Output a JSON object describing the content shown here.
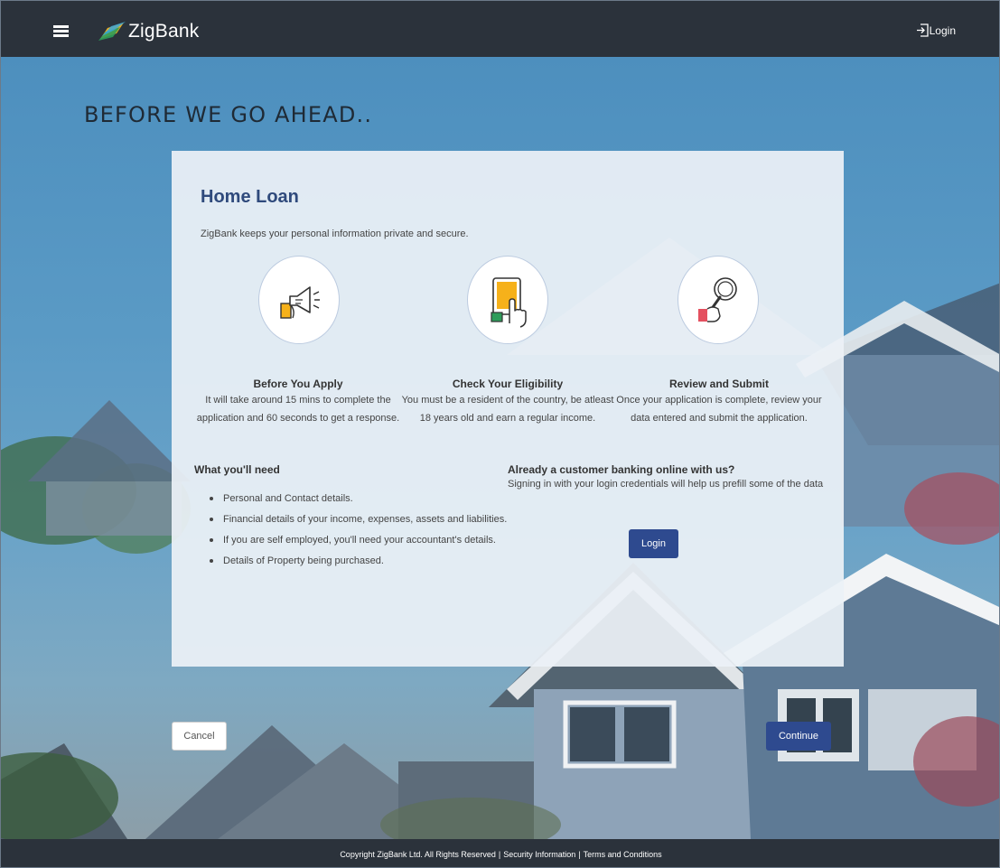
{
  "header": {
    "brand": "ZigBank",
    "login_label": "Login"
  },
  "page": {
    "heading": "BEFORE WE GO AHEAD.."
  },
  "card": {
    "title": "Home Loan",
    "subtitle": "ZigBank keeps your personal information private and secure.",
    "steps": [
      {
        "icon": "megaphone-icon",
        "title": "Before You Apply",
        "description": "It will take around 15 mins to complete the application and 60 seconds to get a response."
      },
      {
        "icon": "tablet-touch-icon",
        "title": "Check Your Eligibility",
        "description": "You must be a resident of the country, be atleast 18 years old and earn a regular income."
      },
      {
        "icon": "magnifier-icon",
        "title": "Review and Submit",
        "description": "Once your application is complete, review your data entered and submit the application."
      }
    ],
    "needs": {
      "title": "What you'll need",
      "items": [
        "Personal and Contact details.",
        "Financial details of your income, expenses, assets and liabilities.",
        "If you are self employed, you'll need your accountant's details.",
        "Details of Property being purchased."
      ]
    },
    "existing_customer": {
      "title": "Already a customer banking online with us?",
      "description": "Signing in with your login credentials will help us prefill some of the data",
      "login_label": "Login"
    }
  },
  "actions": {
    "cancel_label": "Cancel",
    "continue_label": "Continue"
  },
  "footer": {
    "copyright": "Copyright ZigBank Ltd. All Rights Reserved",
    "security_link": "Security Information",
    "terms_link": "Terms and Conditions",
    "separator": "|"
  },
  "colors": {
    "topbar": "#2b323b",
    "primary_button": "#2e4a8f",
    "title_blue": "#2f4a7c",
    "accent_yellow": "#f6b11a",
    "accent_green": "#2e9c5a",
    "accent_red": "#e4505f"
  }
}
